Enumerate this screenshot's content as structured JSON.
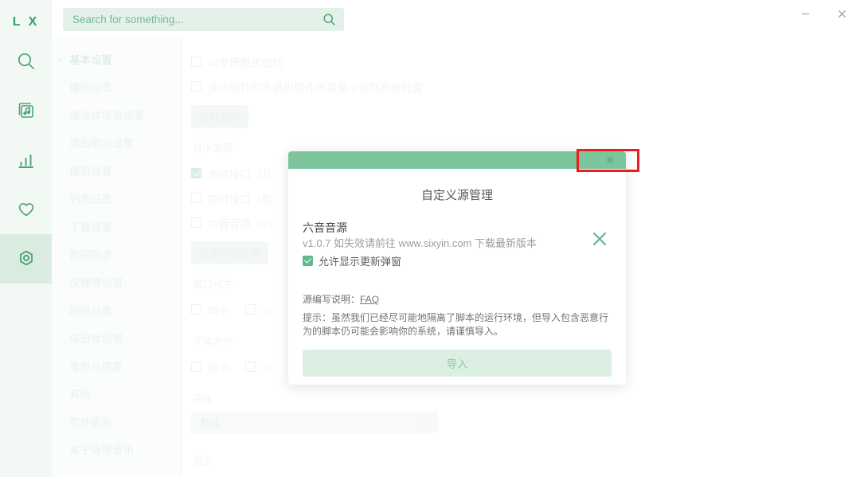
{
  "app": {
    "logo": "L X",
    "window_controls": [
      {
        "name": "minimize",
        "glyph": "–"
      },
      {
        "name": "close",
        "glyph": "✕"
      }
    ]
  },
  "search": {
    "placeholder": "Search for something...",
    "value": "",
    "icon": "search-icon"
  },
  "rail": {
    "items": [
      {
        "name": "search",
        "icon": "search-icon",
        "active": false
      },
      {
        "name": "music-library",
        "icon": "music-library-icon",
        "active": false
      },
      {
        "name": "charts",
        "icon": "bar-chart-icon",
        "active": false
      },
      {
        "name": "favorites",
        "icon": "heart-icon",
        "active": false
      },
      {
        "name": "settings",
        "icon": "gear-hex-icon",
        "active": true
      }
    ]
  },
  "settings_nav": {
    "items": [
      {
        "label": "基本设置",
        "active": true,
        "chevron": "›"
      },
      {
        "label": "播放设置",
        "active": false
      },
      {
        "label": "播放详情页设置",
        "active": false
      },
      {
        "label": "桌面歌词设置",
        "active": false
      },
      {
        "label": "搜索设置",
        "active": false
      },
      {
        "label": "列表设置",
        "active": false
      },
      {
        "label": "下载设置",
        "active": false
      },
      {
        "label": "数据同步",
        "active": false
      },
      {
        "label": "快捷键设置",
        "active": false
      },
      {
        "label": "网络设置",
        "active": false
      },
      {
        "label": "强迫症设置",
        "active": false
      },
      {
        "label": "备份与恢复",
        "active": false
      },
      {
        "label": "其他",
        "active": false
      },
      {
        "label": "软件更新",
        "active": false
      },
      {
        "label": "关于洛雪音乐",
        "active": false
      }
    ]
  },
  "main": {
    "startup_fullscreen": {
      "label": "以全屏模式启动",
      "checked": false
    },
    "minimize_to_tray": {
      "label": "关闭软件时不退出软件将其最小化到系统托盘",
      "checked": false
    },
    "timed_pause_button": "定时暂停",
    "music_source_label": "音乐来源",
    "music_sources": [
      {
        "label": "测试接口（几",
        "checked": true
      },
      {
        "label": "临时接口（软",
        "checked": false
      },
      {
        "label": "六音音源（v1",
        "checked": false
      }
    ],
    "custom_source_button": "自定义源管理",
    "window_size_label": "窗口尺寸",
    "window_size_options": [
      {
        "label": "较小",
        "checked": false
      },
      {
        "label": "小",
        "checked": false
      }
    ],
    "font_size_label": "字体大小",
    "font_size_options": [
      {
        "label": "较小",
        "checked": false
      },
      {
        "label": "小",
        "checked": false
      }
    ],
    "font_label": "字体",
    "font_value": "默认",
    "font_caret": "⌄",
    "language_label": "语言"
  },
  "dialog": {
    "title": "自定义源管理",
    "close_glyph": "✕",
    "source": {
      "name": "六音音源",
      "description": "v1.0.7 如失效请前往 www.sixyin.com 下载最新版本",
      "update_popup_label": "允许显示更新弹窗",
      "update_popup_checked": true,
      "remove_icon": "close-x-icon"
    },
    "faq_prefix": "源编写说明：",
    "faq_link": "FAQ",
    "warning": "提示：虽然我们已经尽可能地隔离了脚本的运行环境，但导入包含恶意行为的脚本仍可能会影响你的系统，请谨慎导入。",
    "import_button": "导入"
  },
  "annotation": {
    "target": "dialog-close-button",
    "color": "#ee1c1c"
  },
  "colors": {
    "accent_green": "#7cc49c",
    "rail_bg": "#f2f9f4",
    "rail_active": "#d9ecdf",
    "search_bg": "#e4f1e9",
    "import_bg": "#dcefe3",
    "annotation_red": "#ee1c1c"
  }
}
